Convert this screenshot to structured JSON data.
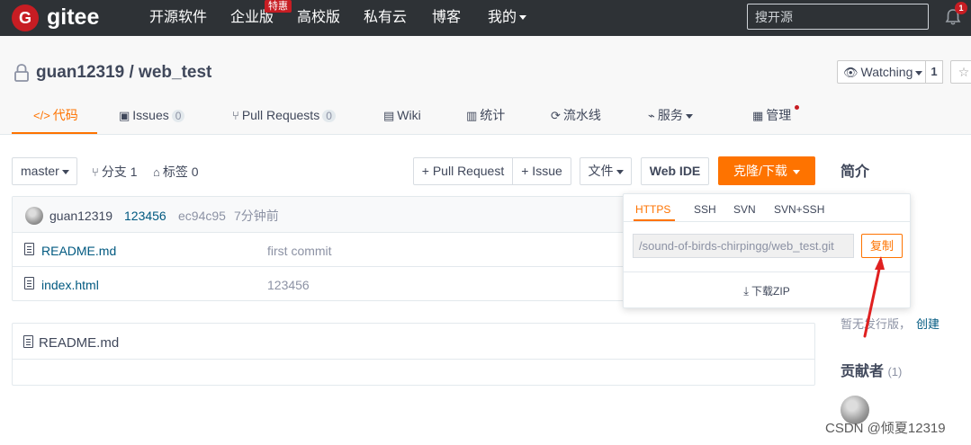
{
  "topnav": {
    "logo_letter": "G",
    "logo_text": "gitee",
    "items": [
      "开源软件",
      "企业版",
      "高校版",
      "私有云",
      "博客",
      "我的"
    ],
    "enterprise_badge": "特惠",
    "search_placeholder": "搜开源",
    "notification_count": "1"
  },
  "repo": {
    "title": "guan12319 / web_test",
    "watch_label": "Watching",
    "watch_count": "1"
  },
  "tabs": {
    "code": "代码",
    "issues": "Issues",
    "issues_count": "0",
    "pull_requests": "Pull Requests",
    "pr_count": "0",
    "wiki": "Wiki",
    "stats": "统计",
    "pipeline": "流水线",
    "services": "服务",
    "manage": "管理"
  },
  "toolbar": {
    "branch": "master",
    "branches": "分支 1",
    "tags": "标签 0",
    "new_pr": "+ Pull Request",
    "new_issue": "+ Issue",
    "file": "文件",
    "web_ide": "Web IDE",
    "clone": "克隆/下载"
  },
  "commit": {
    "author": "guan12319",
    "message": "123456",
    "hash": "ec94c95",
    "time": "7分钟前"
  },
  "files": [
    {
      "name": "README.md",
      "commit": "first commit"
    },
    {
      "name": "index.html",
      "commit": "123456"
    }
  ],
  "readme": {
    "title": "README.md"
  },
  "sidebar": {
    "intro_title": "简介",
    "no_release": "暂无发行版，",
    "create_link": "创建",
    "contributors_title": "贡献者",
    "contributors_count": "(1)"
  },
  "clone_dropdown": {
    "tabs": [
      "HTTPS",
      "SSH",
      "SVN",
      "SVN+SSH"
    ],
    "active_tab": "HTTPS",
    "url": "/sound-of-birds-chirpingg/web_test.git",
    "copy_label": "复制",
    "download_zip": "下载ZIP"
  },
  "watermark": "CSDN @倾夏12319",
  "colors": {
    "accent": "#fe7300",
    "brand": "#c71d23",
    "nav_bg": "#2e3236",
    "link": "#005980",
    "annotation_arrow": "#e02020"
  }
}
